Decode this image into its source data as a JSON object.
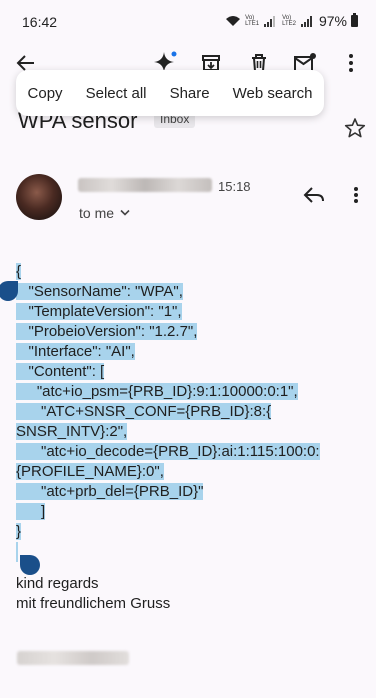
{
  "status_bar": {
    "time": "16:42",
    "sim1_label": "Vo)\nLTE1",
    "sim2_label": "Vo)\nLTE2",
    "battery": "97%"
  },
  "toolbar": {
    "icons": [
      "back-arrow-icon",
      "gemini-sparkle-icon",
      "archive-icon",
      "delete-icon",
      "mark-unread-icon",
      "more-vert-icon"
    ]
  },
  "context_menu": {
    "items": [
      "Copy",
      "Select all",
      "Share",
      "Web search"
    ]
  },
  "email": {
    "subject": "WPA sensor",
    "label": "Inbox",
    "sender_time": "15:18",
    "recipient": "to me",
    "body_lines": [
      "{",
      "   \"SensorName\": \"WPA\",",
      "   \"TemplateVersion\": \"1\",",
      "   \"ProbeioVersion\": \"1.2.7\",",
      "   \"Interface\": \"AI\",",
      "   \"Content\": [",
      "     \"atc+io_psm={PRB_ID}:9:1:10000:0:1\",",
      "      \"ATC+SNSR_CONF={PRB_ID}:8:{",
      "SNSR_INTV}:2\",",
      "      \"atc+io_decode={PRB_ID}:ai:1:115:100:0:",
      "{PROFILE_NAME}:0\",",
      "      \"atc+prb_del={PRB_ID}\"",
      "      ]",
      "}"
    ],
    "closing_line1": "kind regards",
    "closing_line2": "mit freundlichem Gruss"
  },
  "colors": {
    "selection": "#a8d3ec",
    "handle": "#1a4f8a",
    "background": "#fbf8fc"
  }
}
